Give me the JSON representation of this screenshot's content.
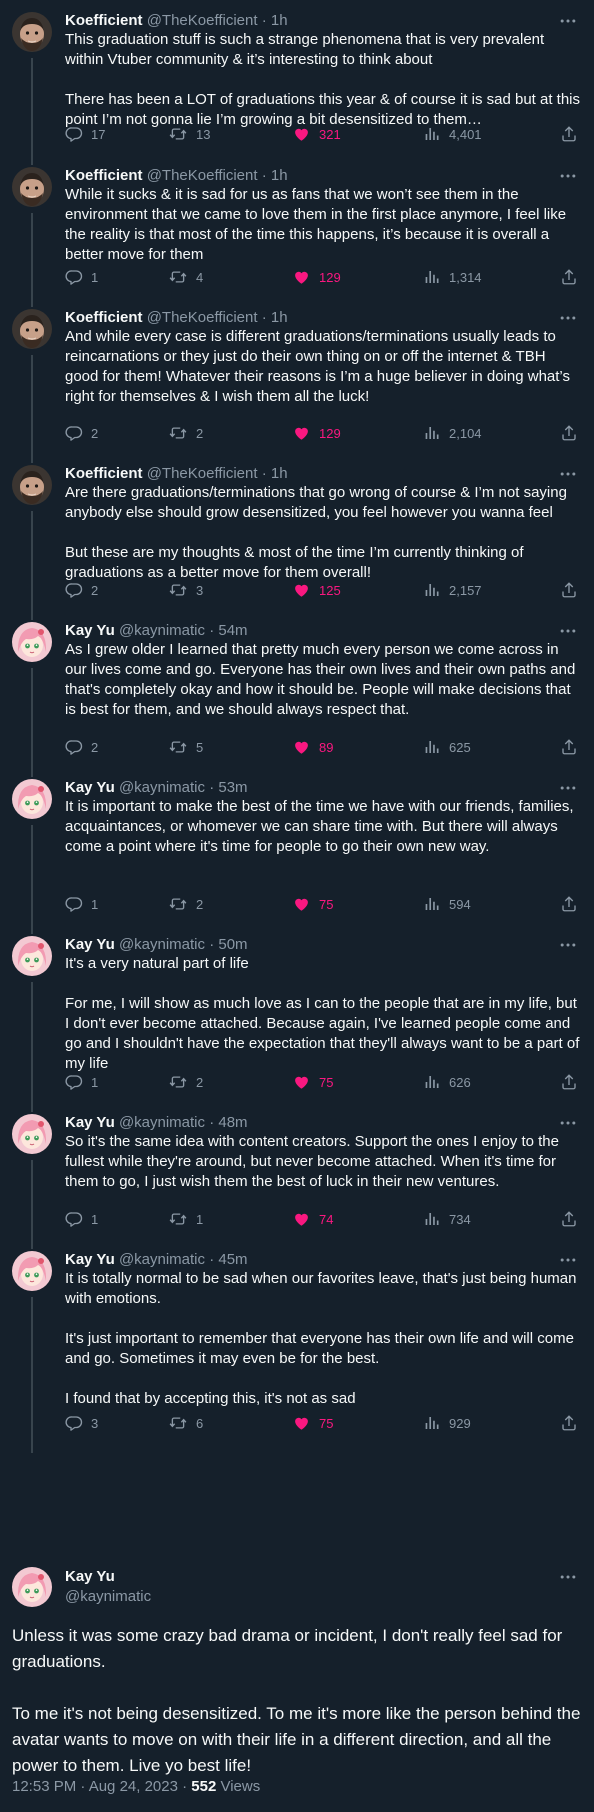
{
  "colors": {
    "background": "#15202b",
    "text": "#f7f9f9",
    "muted": "#8b98a5",
    "like": "#f91880",
    "thread_line": "#38444d"
  },
  "icons": {
    "reply": "reply-icon",
    "retweet": "retweet-icon",
    "like": "heart-icon",
    "views": "views-icon",
    "share": "share-icon",
    "more": "more-icon"
  },
  "tweets": [
    {
      "name": "Koefficient",
      "handle": "@TheKoefficient",
      "separator": "·",
      "time": "1h",
      "text": "This graduation stuff is such a strange phenomena that is very prevalent within Vtuber community & it’s interesting to think about\n\nThere has been a LOT of graduations this year & of course it is sad but at this point I’m not gonna lie I’m growing a bit desensitized to them…",
      "replies": "17",
      "retweets": "13",
      "likes": "321",
      "views": "4,401"
    },
    {
      "name": "Koefficient",
      "handle": "@TheKoefficient",
      "separator": "·",
      "time": "1h",
      "text": "While it sucks & it is sad for us as fans that we won’t see them in the environment that we came to love them in the first place anymore, I feel like the reality is that most of the time this happens, it’s because it is overall a better move for them",
      "replies": "1",
      "retweets": "4",
      "likes": "129",
      "views": "1,314"
    },
    {
      "name": "Koefficient",
      "handle": "@TheKoefficient",
      "separator": "·",
      "time": "1h",
      "text": "And while every case is different graduations/terminations usually leads to reincarnations or they just do their own thing on or off the internet & TBH good for them! Whatever their reasons is I’m a huge believer in doing what’s right for themselves & I wish them all the luck!",
      "replies": "2",
      "retweets": "2",
      "likes": "129",
      "views": "2,104"
    },
    {
      "name": "Koefficient",
      "handle": "@TheKoefficient",
      "separator": "·",
      "time": "1h",
      "text": "Are there graduations/terminations that go wrong of course & I’m not saying anybody else should grow desensitized, you feel however you wanna feel\n\nBut these are my thoughts & most of the time I’m currently thinking of graduations as a better move for them overall!",
      "replies": "2",
      "retweets": "3",
      "likes": "125",
      "views": "2,157"
    },
    {
      "name": "Kay Yu",
      "handle": "@kaynimatic",
      "separator": "·",
      "time": "54m",
      "text": "As I grew older I learned that pretty much every person we come across in our lives come and go. Everyone has their own lives and their own paths and that's completely okay and how it should be. People will make decisions that is best for them, and we should always respect that.",
      "replies": "2",
      "retweets": "5",
      "likes": "89",
      "views": "625"
    },
    {
      "name": "Kay Yu",
      "handle": "@kaynimatic",
      "separator": "·",
      "time": "53m",
      "text": "It is important to make the best of the time we have with our friends, families, acquaintances, or whomever we can share time with. But there will always come a point where it's time for people to go their own new way.",
      "replies": "1",
      "retweets": "2",
      "likes": "75",
      "views": "594"
    },
    {
      "name": "Kay Yu",
      "handle": "@kaynimatic",
      "separator": "·",
      "time": "50m",
      "text": "It's a very natural part of life\n\nFor me, I will show as much love as I can to the people that are in my life, but I don't ever become attached. Because again, I've learned people come and go and I shouldn't have the expectation that they'll always want to be a part of my life",
      "replies": "1",
      "retweets": "2",
      "likes": "75",
      "views": "626"
    },
    {
      "name": "Kay Yu",
      "handle": "@kaynimatic",
      "separator": "·",
      "time": "48m",
      "text": "So it's the same idea with content creators. Support the ones I enjoy to the fullest while they're around, but never become attached. When it's time for them to go, I just wish them the best of luck in their new ventures.",
      "replies": "1",
      "retweets": "1",
      "likes": "74",
      "views": "734"
    },
    {
      "name": "Kay Yu",
      "handle": "@kaynimatic",
      "separator": "·",
      "time": "45m",
      "text": "It is totally normal to be sad when our favorites leave, that's just being human with emotions.\n\nIt's just important to remember that everyone has their own life and will come and go. Sometimes it may even be for the best.\n\nI found that by accepting this, it's not as sad",
      "replies": "3",
      "retweets": "6",
      "likes": "75",
      "views": "929"
    }
  ],
  "main_tweet": {
    "name": "Kay Yu",
    "handle": "@kaynimatic",
    "text": "Unless it was some crazy bad drama or incident, I don't really feel sad for graduations.\n\nTo me it's not being desensitized. To me it's more like the person behind the avatar wants to move on with their life in a different direction, and all the power to them. Live yo best life!",
    "timestamp": "12:53 PM · Aug 24, 2023 · ",
    "views_count": "552",
    "views_label": " Views"
  }
}
